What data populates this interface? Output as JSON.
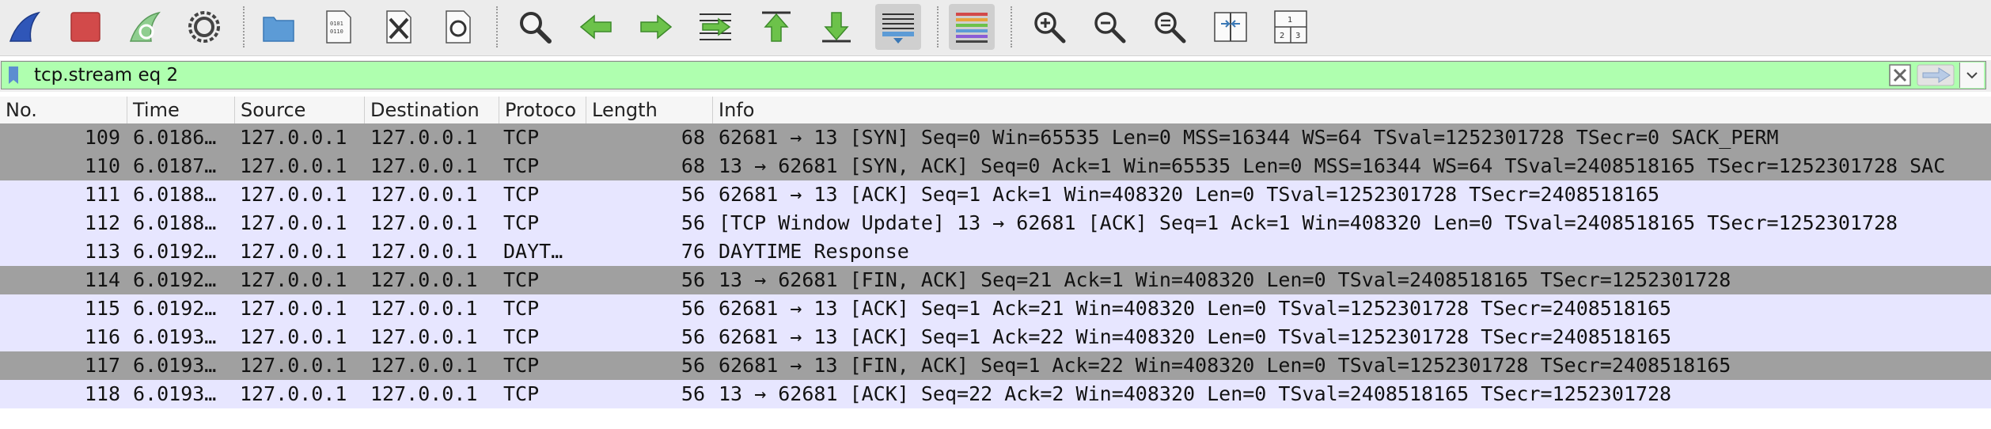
{
  "toolbar": {
    "buttons": [
      {
        "name": "start-capture-icon",
        "color": "#2f56b8"
      },
      {
        "name": "stop-capture-icon",
        "color": "#d24a4a"
      },
      {
        "name": "restart-capture-icon",
        "color": "#7dc27d"
      },
      {
        "name": "capture-options-icon",
        "color": "#555555"
      },
      {
        "name": "open-file-icon",
        "color": "#5c9bd6"
      },
      {
        "name": "save-file-icon"
      },
      {
        "name": "close-file-icon"
      },
      {
        "name": "reload-file-icon"
      },
      {
        "name": "find-packet-icon"
      },
      {
        "name": "go-back-icon",
        "color": "#6cc24a"
      },
      {
        "name": "go-forward-icon",
        "color": "#6cc24a"
      },
      {
        "name": "go-to-packet-icon",
        "color": "#6cc24a"
      },
      {
        "name": "go-to-first-packet-icon",
        "color": "#6cc24a"
      },
      {
        "name": "go-to-last-packet-icon",
        "color": "#6cc24a"
      },
      {
        "name": "auto-scroll-icon",
        "active": true
      },
      {
        "name": "colorize-icon",
        "active": true
      },
      {
        "name": "zoom-in-icon"
      },
      {
        "name": "zoom-out-icon"
      },
      {
        "name": "normal-size-icon"
      },
      {
        "name": "resize-columns-icon"
      },
      {
        "name": "layout-panes-icon"
      }
    ]
  },
  "filter": {
    "value": "tcp.stream eq 2",
    "background": "#afffaf"
  },
  "columns": [
    "No.",
    "Time",
    "Source",
    "Destination",
    "Protoco",
    "Length",
    "Info"
  ],
  "rows": [
    {
      "no": "109",
      "time": "6.0186…",
      "source": "127.0.0.1",
      "destination": "127.0.0.1",
      "protocol": "TCP",
      "length": "68",
      "info": "62681 → 13 [SYN] Seq=0 Win=65535 Len=0 MSS=16344 WS=64 TSval=1252301728 TSecr=0 SACK_PERM",
      "style": "dark"
    },
    {
      "no": "110",
      "time": "6.0187…",
      "source": "127.0.0.1",
      "destination": "127.0.0.1",
      "protocol": "TCP",
      "length": "68",
      "info": "13 → 62681 [SYN, ACK] Seq=0 Ack=1 Win=65535 Len=0 MSS=16344 WS=64 TSval=2408518165 TSecr=1252301728 SAC",
      "style": "dark"
    },
    {
      "no": "111",
      "time": "6.0188…",
      "source": "127.0.0.1",
      "destination": "127.0.0.1",
      "protocol": "TCP",
      "length": "56",
      "info": "62681 → 13 [ACK] Seq=1 Ack=1 Win=408320 Len=0 TSval=1252301728 TSecr=2408518165",
      "style": "light"
    },
    {
      "no": "112",
      "time": "6.0188…",
      "source": "127.0.0.1",
      "destination": "127.0.0.1",
      "protocol": "TCP",
      "length": "56",
      "info": "[TCP Window Update] 13 → 62681 [ACK] Seq=1 Ack=1 Win=408320 Len=0 TSval=2408518165 TSecr=1252301728",
      "style": "light"
    },
    {
      "no": "113",
      "time": "6.0192…",
      "source": "127.0.0.1",
      "destination": "127.0.0.1",
      "protocol": "DAYT…",
      "length": "76",
      "info": "DAYTIME Response",
      "style": "light"
    },
    {
      "no": "114",
      "time": "6.0192…",
      "source": "127.0.0.1",
      "destination": "127.0.0.1",
      "protocol": "TCP",
      "length": "56",
      "info": "13 → 62681 [FIN, ACK] Seq=21 Ack=1 Win=408320 Len=0 TSval=2408518165 TSecr=1252301728",
      "style": "dark"
    },
    {
      "no": "115",
      "time": "6.0192…",
      "source": "127.0.0.1",
      "destination": "127.0.0.1",
      "protocol": "TCP",
      "length": "56",
      "info": "62681 → 13 [ACK] Seq=1 Ack=21 Win=408320 Len=0 TSval=1252301728 TSecr=2408518165",
      "style": "light"
    },
    {
      "no": "116",
      "time": "6.0193…",
      "source": "127.0.0.1",
      "destination": "127.0.0.1",
      "protocol": "TCP",
      "length": "56",
      "info": "62681 → 13 [ACK] Seq=1 Ack=22 Win=408320 Len=0 TSval=1252301728 TSecr=2408518165",
      "style": "light"
    },
    {
      "no": "117",
      "time": "6.0193…",
      "source": "127.0.0.1",
      "destination": "127.0.0.1",
      "protocol": "TCP",
      "length": "56",
      "info": "62681 → 13 [FIN, ACK] Seq=1 Ack=22 Win=408320 Len=0 TSval=1252301728 TSecr=2408518165",
      "style": "dark"
    },
    {
      "no": "118",
      "time": "6.0193…",
      "source": "127.0.0.1",
      "destination": "127.0.0.1",
      "protocol": "TCP",
      "length": "56",
      "info": "13 → 62681 [ACK] Seq=22 Ack=2 Win=408320 Len=0 TSval=2408518165 TSecr=1252301728",
      "style": "light"
    }
  ],
  "colors": {
    "row_dark": "#a0a0a0",
    "row_light": "#e7e6ff",
    "toolbar_bg": "#ececec"
  }
}
